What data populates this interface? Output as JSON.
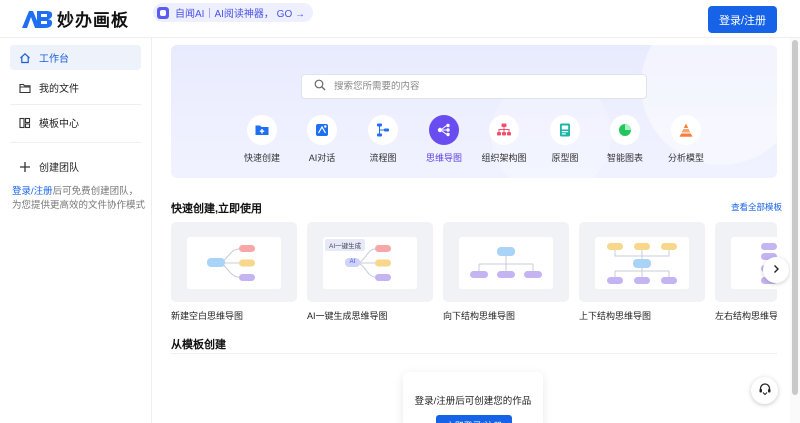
{
  "header": {
    "logo_text": "妙办画板",
    "promo_text": "自闻AI｜AI阅读神器， GO →",
    "login_label": "登录/注册"
  },
  "sidebar": {
    "items": [
      {
        "label": "工作台",
        "icon": "home-icon",
        "active": true
      },
      {
        "label": "我的文件",
        "icon": "folder-icon",
        "active": false
      },
      {
        "label": "模板中心",
        "icon": "template-icon",
        "active": false
      },
      {
        "label": "创建团队",
        "icon": "plus-icon",
        "active": false
      }
    ],
    "note_link": "登录/注册",
    "note_text": "后可免费创建团队，为您提供更高效的文件协作模式"
  },
  "search": {
    "placeholder": "搜索您所需要的内容"
  },
  "tools": [
    {
      "label": "快速创建",
      "icon": "folder-plus-icon"
    },
    {
      "label": "AI对话",
      "icon": "ai-chat-icon"
    },
    {
      "label": "流程图",
      "icon": "flowchart-icon"
    },
    {
      "label": "思维导图",
      "icon": "mindmap-icon",
      "active": true
    },
    {
      "label": "组织架构图",
      "icon": "org-chart-icon"
    },
    {
      "label": "原型图",
      "icon": "prototype-icon"
    },
    {
      "label": "智能图表",
      "icon": "pie-chart-icon"
    },
    {
      "label": "分析模型",
      "icon": "pyramid-icon"
    }
  ],
  "quick_create": {
    "title": "快速创建,立即使用",
    "view_all": "查看全部模板",
    "cards": [
      {
        "label": "新建空白思维导图"
      },
      {
        "label": "AI一键生成思维导图",
        "badge": "AI一键生成",
        "chip": "AI"
      },
      {
        "label": "向下结构思维导图"
      },
      {
        "label": "上下结构思维导图"
      },
      {
        "label": "左右结构思维导图"
      }
    ]
  },
  "from_template": {
    "title": "从模板创建",
    "login_prompt": "登录/注册后可创建您的作品",
    "login_button": "立即登录/注册"
  },
  "colors": {
    "accent": "#1763e8",
    "mindmap_active": "#6a4df0",
    "hero_bg": "#e8ebfd"
  }
}
